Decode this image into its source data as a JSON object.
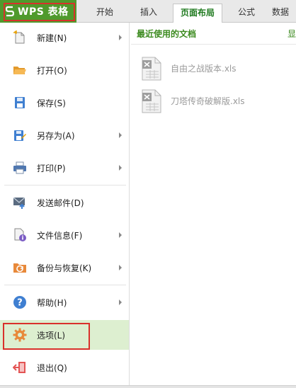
{
  "app": {
    "button_label": "WPS 表格"
  },
  "tabs": [
    {
      "label": "开始"
    },
    {
      "label": "插入"
    },
    {
      "label": "页面布局"
    },
    {
      "label": "公式"
    },
    {
      "label": "数据"
    }
  ],
  "menu": {
    "items": [
      {
        "label": "新建(N)",
        "icon": "new-file-icon",
        "submenu": true
      },
      {
        "label": "打开(O)",
        "icon": "open-folder-icon",
        "submenu": false
      },
      {
        "label": "保存(S)",
        "icon": "save-icon",
        "submenu": false
      },
      {
        "label": "另存为(A)",
        "icon": "save-as-icon",
        "submenu": true
      },
      {
        "label": "打印(P)",
        "icon": "printer-icon",
        "submenu": true
      },
      {
        "label": "发送邮件(D)",
        "icon": "mail-icon",
        "submenu": false
      },
      {
        "label": "文件信息(F)",
        "icon": "file-info-icon",
        "submenu": true
      },
      {
        "label": "备份与恢复(K)",
        "icon": "backup-icon",
        "submenu": true
      },
      {
        "label": "帮助(H)",
        "icon": "help-icon",
        "submenu": true
      },
      {
        "label": "选项(L)",
        "icon": "gear-icon",
        "submenu": false
      },
      {
        "label": "退出(Q)",
        "icon": "exit-icon",
        "submenu": false
      }
    ],
    "selected": "选项(L)"
  },
  "recent": {
    "title": "最近使用的文档",
    "more": "显",
    "files": [
      {
        "name": "自由之战版本.xls",
        "icon": "excel-file-icon"
      },
      {
        "name": "刀塔传奇破解版.xls",
        "icon": "excel-file-icon"
      }
    ]
  },
  "colors": {
    "brand_green": "#4f9a2c",
    "highlight_red": "#d9312b",
    "selected_bg": "#ddefd0",
    "accent_text_green": "#3b8a1e"
  }
}
